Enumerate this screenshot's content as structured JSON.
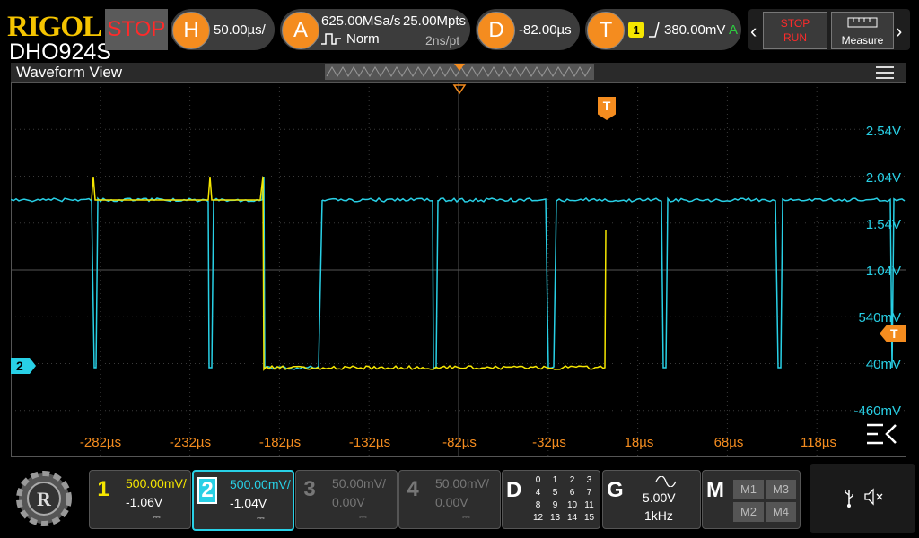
{
  "brand": {
    "logo": "RIGOL",
    "model": "DHO924S"
  },
  "run_state": {
    "label": "STOP"
  },
  "horizontal": {
    "key": "H",
    "timebase": "50.00µs/"
  },
  "acquire": {
    "key": "A",
    "sample_rate": "625.00MSa/s",
    "memory": "25.00Mpts",
    "mode": "Norm",
    "resolution": "2ns/pt"
  },
  "delay": {
    "key": "D",
    "value": "-82.00µs"
  },
  "trigger": {
    "key": "T",
    "source": "1",
    "level": "380.00mV",
    "mode": "A"
  },
  "controls": {
    "stop_label": "STOP",
    "run_label": "RUN",
    "measure_label": "Measure"
  },
  "waveform": {
    "title": "Waveform View",
    "y_labels": [
      "2.54V",
      "2.04V",
      "1.54V",
      "1.04V",
      "540mV",
      "40mV",
      "-460mV"
    ],
    "x_labels": [
      "-282µs",
      "-232µs",
      "-182µs",
      "-132µs",
      "-82µs",
      "-32µs",
      "18µs",
      "68µs",
      "118µs"
    ],
    "ch2_marker": "2",
    "trigger_marker": "T"
  },
  "channels": [
    {
      "num": "1",
      "scale": "500.00mV/",
      "offset": "-1.06V",
      "color": "#f5e600",
      "active": true
    },
    {
      "num": "2",
      "scale": "500.00mV/",
      "offset": "-1.04V",
      "color": "#28d0e6",
      "active": true
    },
    {
      "num": "3",
      "scale": "50.00mV/",
      "offset": "0.00V",
      "color": "#777777",
      "active": false
    },
    {
      "num": "4",
      "scale": "50.00mV/",
      "offset": "0.00V",
      "color": "#777777",
      "active": false
    }
  ],
  "digital": {
    "key": "D",
    "rows": [
      [
        "0",
        "1",
        "2",
        "3"
      ],
      [
        "4",
        "5",
        "6",
        "7"
      ],
      [
        "8",
        "9",
        "10",
        "11"
      ],
      [
        "12",
        "13",
        "14",
        "15"
      ]
    ]
  },
  "generator": {
    "key": "G",
    "amplitude": "5.00V",
    "frequency": "1kHz"
  },
  "math": {
    "key": "M",
    "items": [
      "M1",
      "M3",
      "M2",
      "M4"
    ]
  },
  "colors": {
    "ch1": "#f5e600",
    "ch2": "#28d0e6",
    "accent": "#f48c1f",
    "stop": "#ff2a2a"
  }
}
